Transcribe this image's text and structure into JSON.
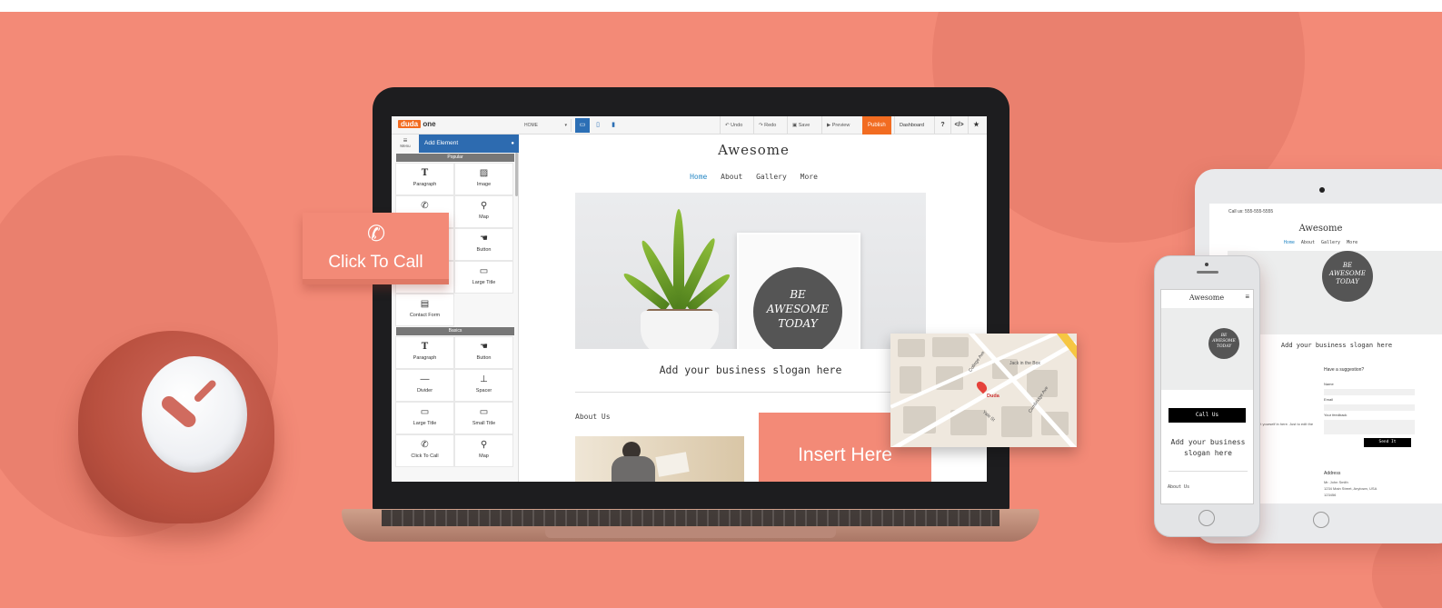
{
  "colors": {
    "background": "#f38a77",
    "accent": "#f26c21",
    "panel_blue": "#2d6bb0",
    "link": "#2b8ac6"
  },
  "editor": {
    "logo": {
      "brand": "duda",
      "suffix": "one"
    },
    "page_select": "HOME",
    "devices": [
      "desktop-icon",
      "tablet-icon",
      "mobile-icon"
    ],
    "toolbar": {
      "undo": "Undo",
      "redo": "Redo",
      "save": "Save",
      "preview": "Preview",
      "publish": "Publish",
      "dashboard": "Dashboard"
    },
    "panel": {
      "menu_label": "Menu",
      "header": "Add Element",
      "sections": {
        "popular": "Popular",
        "basics": "Basics"
      },
      "popular_tiles": [
        "Paragraph",
        "Image",
        "Map",
        "Button",
        "Large Title",
        "Contact Form"
      ],
      "basics_tiles": [
        "Paragraph",
        "Button",
        "Divider",
        "Spacer",
        "Large Title",
        "Small Title",
        "Click To Call",
        "Map"
      ]
    }
  },
  "site": {
    "title": "Awesome",
    "nav": [
      "Home",
      "About",
      "Gallery",
      "More"
    ],
    "hero_text": [
      "BE",
      "AWESOME",
      "TODAY"
    ],
    "slogan": "Add your business slogan here",
    "about_heading": "About Us",
    "insert_label": "Insert Here"
  },
  "click_to_call": {
    "label": "Click To Call",
    "icon": "phone-icon"
  },
  "map": {
    "labels": [
      "Jack in the Box",
      "Duda",
      "College Ave",
      "Cambridge Ave",
      "Yale St"
    ]
  },
  "tablet": {
    "call_us": "Call us: 555-555-5555",
    "title": "Awesome",
    "nav": [
      "Home",
      "About",
      "Gallery",
      "More"
    ],
    "hero_text": [
      "BE",
      "AWESOME",
      "TODAY"
    ],
    "slogan": "Add your business slogan here",
    "suggestion": "Have a suggestion?",
    "fields": [
      "Name",
      "Email",
      "Your feedback"
    ],
    "send": "Send It",
    "paragraph": "graph about yourself in here. Just to edit the text.",
    "address_heading": "Address",
    "address_lines": [
      "Mr. John Smith",
      "1234 Main Street, Anytown, USA",
      "123456"
    ]
  },
  "phone": {
    "title": "Awesome",
    "hero_text": [
      "BE",
      "AWESOME",
      "TODAY"
    ],
    "call_us": "Call Us",
    "slogan": "Add your business slogan here",
    "about": "About Us"
  }
}
